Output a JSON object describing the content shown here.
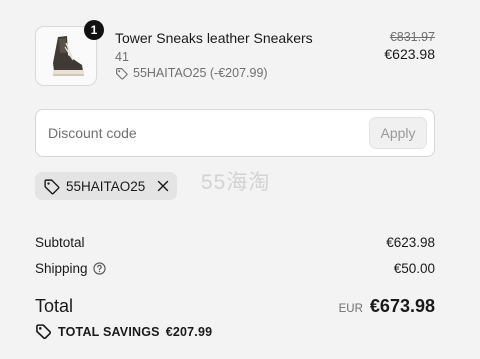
{
  "line_item": {
    "quantity": "1",
    "title": "Tower Sneaks leather Sneakers",
    "variant": "41",
    "discount": "55HAITAO25 (-€207.99)",
    "price_original": "€831.97",
    "price_final": "€623.98",
    "image_icon": "sneaker-icon"
  },
  "discount_field": {
    "placeholder": "Discount code",
    "apply_label": "Apply"
  },
  "applied_code": {
    "code": "55HAITAO25",
    "tag_icon": "tag-icon",
    "remove_icon": "close-icon"
  },
  "watermark": "55海淘",
  "summary": {
    "subtotal_label": "Subtotal",
    "subtotal_value": "€623.98",
    "shipping_label": "Shipping",
    "shipping_value": "€50.00",
    "total_label": "Total",
    "currency": "EUR",
    "total_value": "€673.98",
    "savings_label": "TOTAL SAVINGS",
    "savings_value": "€207.99"
  },
  "colors": {
    "background": "#f3f3f3",
    "text": "#1a1a1a",
    "muted": "#707070",
    "badge": "#111111",
    "chip": "#e4e4e4"
  }
}
